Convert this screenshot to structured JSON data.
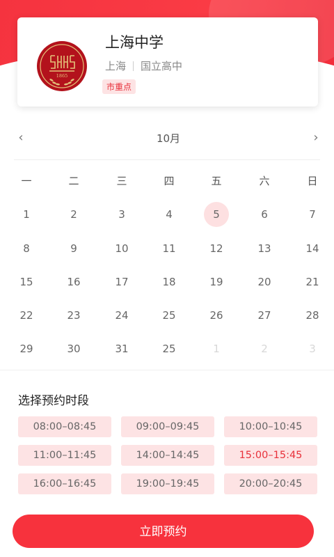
{
  "school": {
    "name": "上海中学",
    "city": "上海",
    "type": "国立高中",
    "tag": "市重点",
    "logo_text": "1865"
  },
  "calendar": {
    "month_label": "10月",
    "prev_icon": "chevron-left-icon",
    "next_icon": "chevron-right-icon",
    "weekdays": [
      "一",
      "二",
      "三",
      "四",
      "五",
      "六",
      "日"
    ],
    "weeks": [
      [
        "1",
        "2",
        "3",
        "4",
        "5",
        "6",
        "7"
      ],
      [
        "8",
        "9",
        "10",
        "11",
        "12",
        "13",
        "14"
      ],
      [
        "15",
        "16",
        "17",
        "18",
        "19",
        "20",
        "21"
      ],
      [
        "22",
        "23",
        "24",
        "25",
        "26",
        "27",
        "28"
      ],
      [
        "29",
        "30",
        "31",
        "25",
        "1",
        "2",
        "3"
      ]
    ],
    "selected_day": "5",
    "selected_color": "#fde0e1"
  },
  "booking": {
    "section_title": "选择预约时段",
    "slots": [
      "08:00–08:45",
      "09:00–09:45",
      "10:00–10:45",
      "11:00–11:45",
      "14:00–14:45",
      "15:00–15:45",
      "16:00–16:45",
      "19:00–19:45",
      "20:00–20:45"
    ],
    "active_slot": "15:00–15:45",
    "submit_label": "立即预约"
  },
  "colors": {
    "accent": "#f7323d",
    "slot_bg": "#fde3e4",
    "active_text": "#e8303a",
    "logo_red": "#b3121c",
    "logo_gold": "#e4c27a"
  }
}
